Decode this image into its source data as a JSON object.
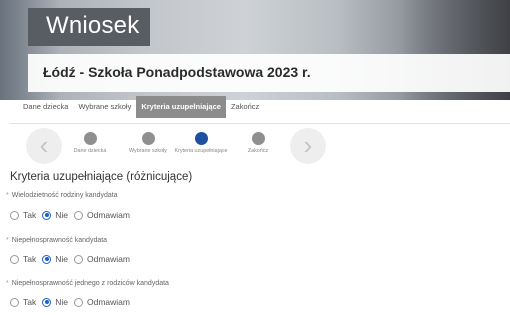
{
  "header": {
    "title": "Wniosek",
    "subtitle": "Łódź - Szkoła Ponadpodstawowa 2023 r."
  },
  "tabs": [
    {
      "label": "Dane dziecka",
      "active": false
    },
    {
      "label": "Wybrane szkoły",
      "active": false
    },
    {
      "label": "Kryteria uzupełniające",
      "active": true
    },
    {
      "label": "Zakończ",
      "active": false
    }
  ],
  "stepper": {
    "prev_icon": "chevron-left-icon",
    "next_icon": "chevron-right-icon",
    "prev_glyph": "‹",
    "next_glyph": "›",
    "steps": [
      {
        "label": "Dane dziecka"
      },
      {
        "label": "Wybrane szkoły"
      },
      {
        "label": "Kryteria uzupełniające"
      },
      {
        "label": "Zakończ"
      }
    ],
    "active_index": 2,
    "active_color": "#1f4fa0"
  },
  "section": {
    "title": "Kryteria uzupełniające (różnicujące)"
  },
  "options": {
    "tak": "Tak",
    "nie": "Nie",
    "odmawiam": "Odmawiam"
  },
  "questions": [
    {
      "star": "*",
      "label": "Wielodzietność rodziny kandydata",
      "selected": "Nie"
    },
    {
      "star": "*",
      "label": "Niepełnosprawność kandydata",
      "selected": "Nie"
    },
    {
      "star": "*",
      "label": "Niepełnosprawność jednego z rodziców kandydata",
      "selected": "Nie"
    }
  ]
}
